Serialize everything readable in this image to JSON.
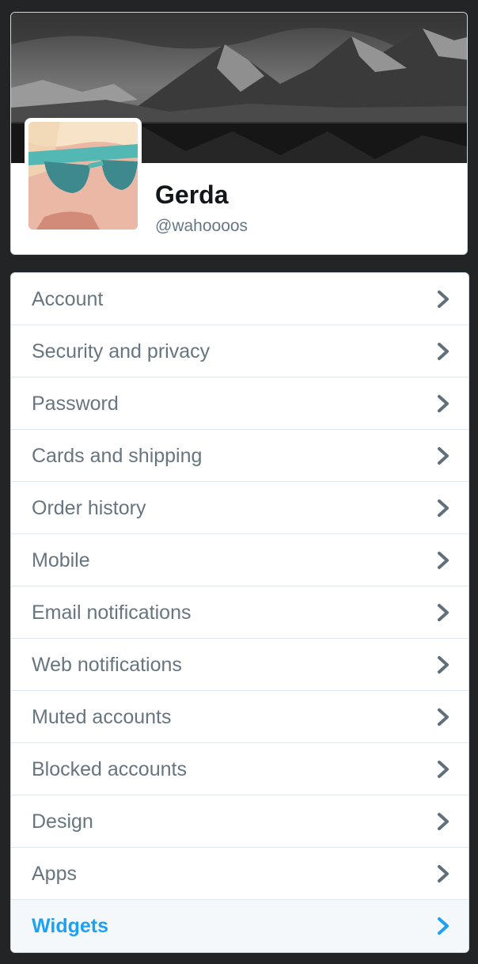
{
  "profile": {
    "display_name": "Gerda",
    "screen_name": "@wahoooos"
  },
  "menu": {
    "items": [
      {
        "label": "Account",
        "name": "account",
        "active": false
      },
      {
        "label": "Security and privacy",
        "name": "security-and-privacy",
        "active": false
      },
      {
        "label": "Password",
        "name": "password",
        "active": false
      },
      {
        "label": "Cards and shipping",
        "name": "cards-and-shipping",
        "active": false
      },
      {
        "label": "Order history",
        "name": "order-history",
        "active": false
      },
      {
        "label": "Mobile",
        "name": "mobile",
        "active": false
      },
      {
        "label": "Email notifications",
        "name": "email-notifications",
        "active": false
      },
      {
        "label": "Web notifications",
        "name": "web-notifications",
        "active": false
      },
      {
        "label": "Muted accounts",
        "name": "muted-accounts",
        "active": false
      },
      {
        "label": "Blocked accounts",
        "name": "blocked-accounts",
        "active": false
      },
      {
        "label": "Design",
        "name": "design",
        "active": false
      },
      {
        "label": "Apps",
        "name": "apps",
        "active": false
      },
      {
        "label": "Widgets",
        "name": "widgets",
        "active": true
      }
    ],
    "chevron_icon": "chevron-right-icon"
  },
  "colors": {
    "page_background": "#232426",
    "text_primary": "#14171a",
    "text_secondary": "#66757f",
    "accent": "#1da1f2",
    "chevron": "#5f6f7c",
    "active_background": "#f5f8fa"
  }
}
